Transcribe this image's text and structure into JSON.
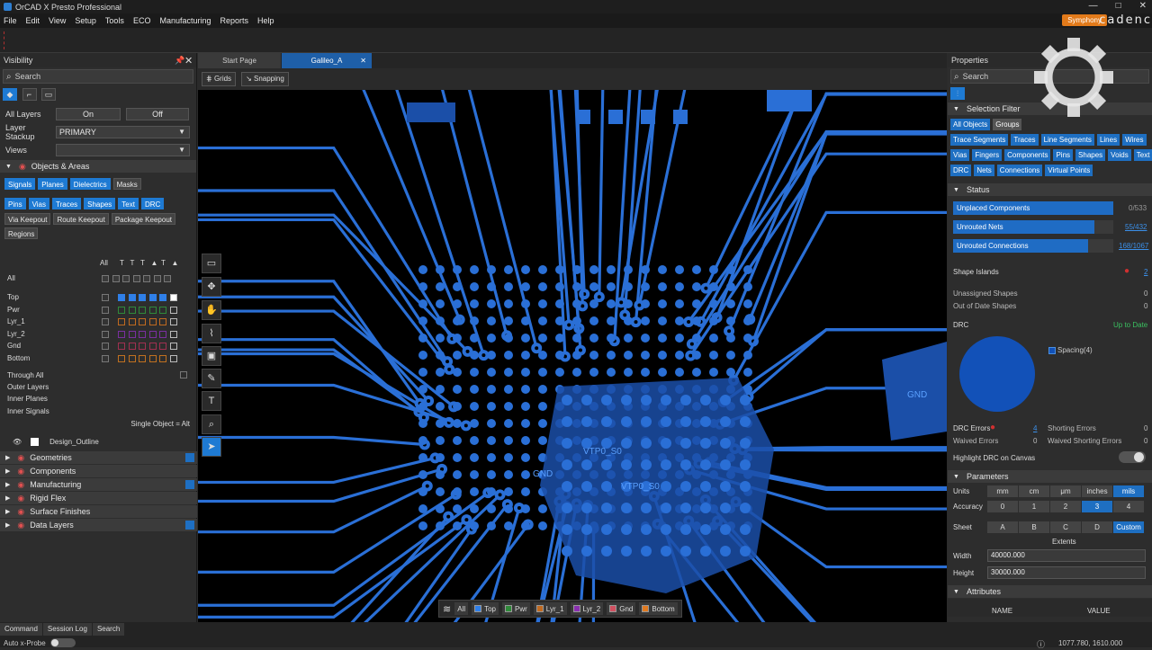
{
  "window": {
    "title": "OrCAD X Presto Professional",
    "controls": [
      "—",
      "□",
      "✕"
    ]
  },
  "menu": [
    "File",
    "Edit",
    "View",
    "Setup",
    "Tools",
    "ECO",
    "Manufacturing",
    "Reports",
    "Help"
  ],
  "brand": {
    "symphony": "Symphony",
    "cadence": "cadenc"
  },
  "visibility": {
    "title": "Visibility",
    "search": "Search",
    "all_layers_label": "All Layers",
    "on": "On",
    "off": "Off",
    "stackup_label": "Layer Stackup",
    "stackup_value": "PRIMARY",
    "views_label": "Views",
    "views_value": "",
    "objects_section": "Objects & Areas",
    "chips1": [
      {
        "t": "Signals",
        "on": true
      },
      {
        "t": "Planes",
        "on": true
      },
      {
        "t": "Dielectrics",
        "on": true
      },
      {
        "t": "Masks",
        "on": false
      }
    ],
    "chips2": [
      {
        "t": "Pins",
        "on": true
      },
      {
        "t": "Vias",
        "on": true
      },
      {
        "t": "Traces",
        "on": true
      },
      {
        "t": "Shapes",
        "on": true
      },
      {
        "t": "Text",
        "on": true
      },
      {
        "t": "DRC",
        "on": true
      }
    ],
    "chips3": [
      {
        "t": "Via Keepout",
        "on": false
      },
      {
        "t": "Route Keepout",
        "on": false
      },
      {
        "t": "Package Keepout",
        "on": false
      },
      {
        "t": "Regions",
        "on": false
      }
    ],
    "all_col": "All",
    "all_row": "All",
    "layers": [
      {
        "name": "Top",
        "color": "#2f7fe8"
      },
      {
        "name": "Pwr",
        "color": "#2f8a3a"
      },
      {
        "name": "Lyr_1",
        "color": "#c06a20"
      },
      {
        "name": "Lyr_2",
        "color": "#7a2fa0"
      },
      {
        "name": "Gnd",
        "color": "#a03050"
      },
      {
        "name": "Bottom",
        "color": "#c07020"
      }
    ],
    "through_all": "Through All",
    "outer_layers": "Outer Layers",
    "inner_planes": "Inner Planes",
    "inner_signals": "Inner Signals",
    "single_object": "Single Object = Alt",
    "design_outline": "Design_Outline",
    "sections": [
      "Geometries",
      "Components",
      "Manufacturing",
      "Rigid Flex",
      "Surface Finishes",
      "Data Layers"
    ]
  },
  "tabs": [
    {
      "label": "Start Page",
      "active": false
    },
    {
      "label": "Galileo_A",
      "active": true
    }
  ],
  "subbar": {
    "grids": "Grids",
    "snapping": "Snapping"
  },
  "canvas_labels": {
    "gnd": "GND",
    "vtp1": "VTP0_S0",
    "vtp2": "VTP0_S0",
    "gnd2": "GND"
  },
  "layerbar": [
    {
      "name": "All",
      "color": ""
    },
    {
      "name": "Top",
      "color": "#2f7fe8"
    },
    {
      "name": "Pwr",
      "color": "#2f8a3a"
    },
    {
      "name": "Lyr_1",
      "color": "#c06a20"
    },
    {
      "name": "Lyr_2",
      "color": "#8a2fb0"
    },
    {
      "name": "Gnd",
      "color": "#d05060"
    },
    {
      "name": "Bottom",
      "color": "#e07a20"
    }
  ],
  "properties": {
    "title": "Properties",
    "search": "Search",
    "selection_filter": "Selection Filter",
    "filter_rows": [
      [
        "All Objects",
        "Groups"
      ],
      [
        "Trace Segments",
        "Traces",
        "Line Segments",
        "Lines",
        "Wires"
      ],
      [
        "Vias",
        "Fingers",
        "Components",
        "Pins",
        "Shapes",
        "Voids",
        "Text"
      ],
      [
        "DRC",
        "Nets",
        "Connections",
        "Virtual Points"
      ]
    ],
    "status": "Status",
    "unplaced": {
      "label": "Unplaced Components",
      "value": "0/533",
      "fill": 1.0
    },
    "unrouted_nets": {
      "label": "Unrouted Nets",
      "value": "55/432",
      "fill": 0.88
    },
    "unrouted_conn": {
      "label": "Unrouted Connections",
      "value": "168/1067",
      "fill": 0.84
    },
    "shape_islands": "Shape Islands",
    "shape_islands_val": "2",
    "unassigned": "Unassigned Shapes",
    "unassigned_val": "0",
    "outofdate": "Out of Date Shapes",
    "outofdate_val": "0",
    "drc": "DRC",
    "up_to_date": "Up to Date",
    "spacing": "Spacing(4)",
    "drc_errors": "DRC Errors",
    "drc_errors_val": "4",
    "waived": "Waived Errors",
    "waived_val": "0",
    "shorting": "Shorting Errors",
    "shorting_val": "0",
    "waived_shorting": "Waived Shorting Errors",
    "waived_shorting_val": "0",
    "highlight": "Highlight DRC on Canvas",
    "parameters": "Parameters",
    "units_label": "Units",
    "units": [
      "mm",
      "cm",
      "μm",
      "inches",
      "mils"
    ],
    "units_on": 4,
    "accuracy_label": "Accuracy",
    "accuracy": [
      "0",
      "1",
      "2",
      "3",
      "4"
    ],
    "accuracy_on": 3,
    "sheet_label": "Sheet",
    "sheet": [
      "A",
      "B",
      "C",
      "D",
      "Custom"
    ],
    "sheet_on": 4,
    "extents": "Extents",
    "width_label": "Width",
    "width_val": "40000.000",
    "height_label": "Height",
    "height_val": "30000.000",
    "attributes": "Attributes",
    "name_col": "NAME",
    "value_col": "VALUE"
  },
  "statusbar": {
    "tabs": [
      "Command",
      "Session Log",
      "Search"
    ],
    "autoprobe": "Auto x-Probe",
    "coords": "1077.780, 1610.000"
  }
}
